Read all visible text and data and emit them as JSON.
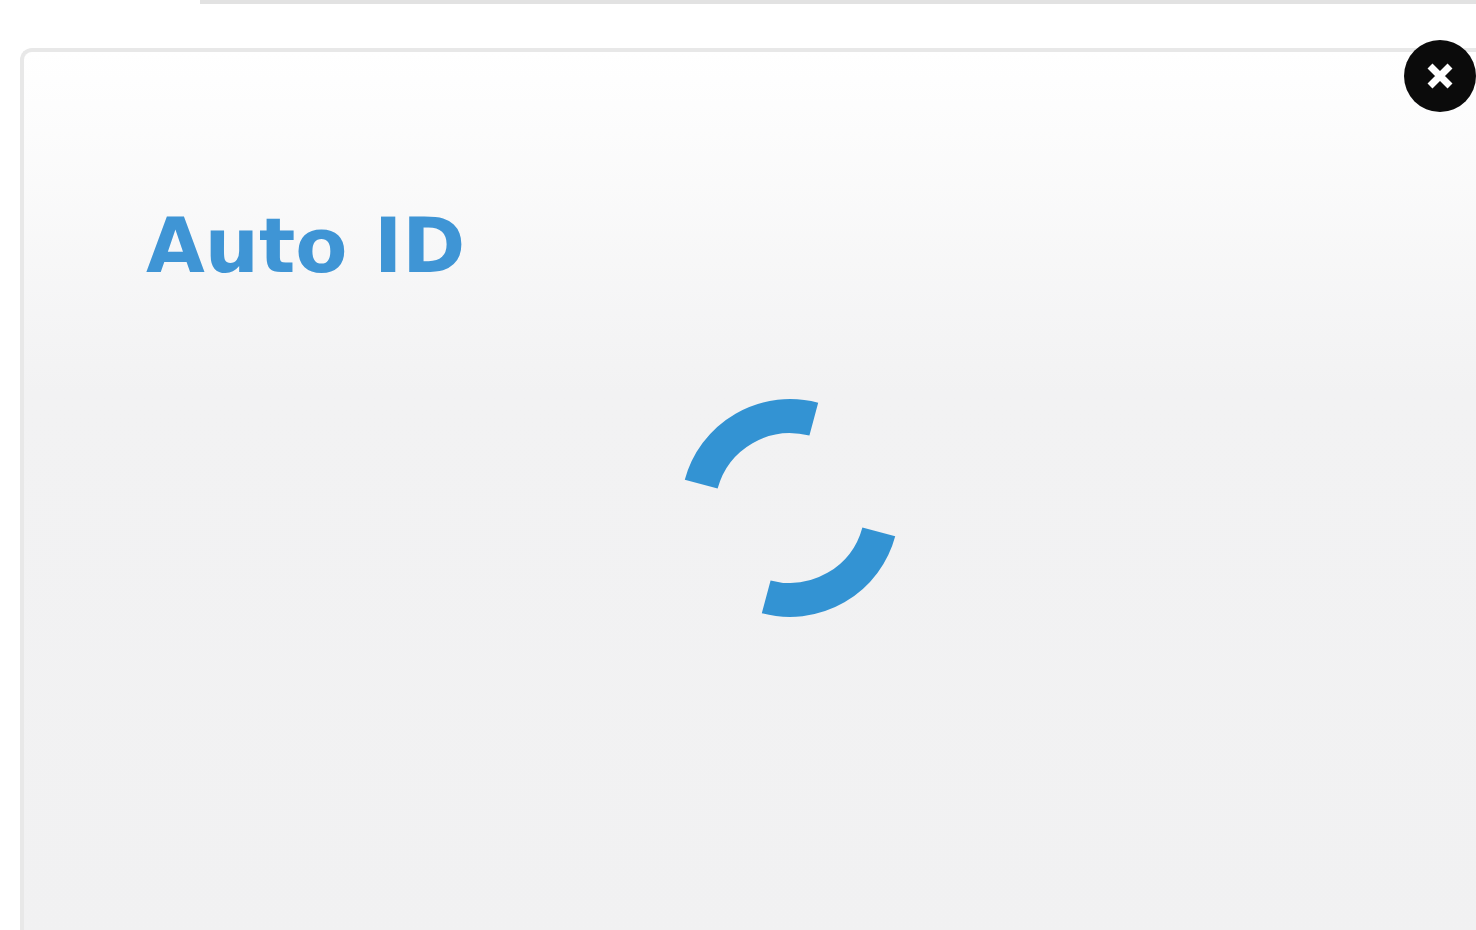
{
  "dialog": {
    "title": "Auto ID"
  }
}
